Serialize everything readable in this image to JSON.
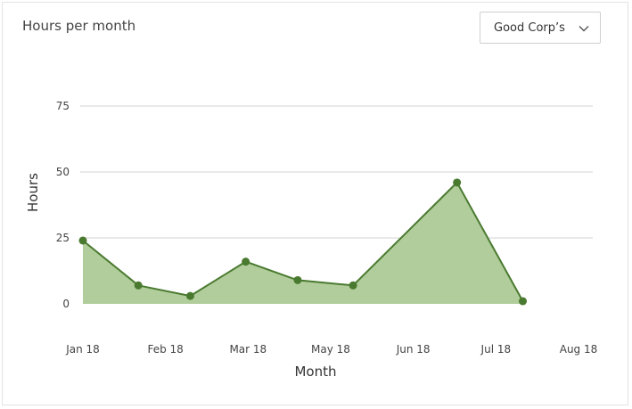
{
  "card": {
    "title": "Hours per month"
  },
  "dropdown": {
    "selected": "Good Corp’s"
  },
  "colors": {
    "line": "#4a7a30",
    "area": "#b1cd9b",
    "grid": "#d3d3d3"
  },
  "chart_data": {
    "type": "area",
    "title": "Hours per month",
    "xlabel": "Month",
    "ylabel": "Hours",
    "ylim": [
      0,
      75
    ],
    "yticks": [
      0,
      25,
      50,
      75
    ],
    "grid": true,
    "x_tick_labels": [
      "Jan 18",
      "Feb 18",
      "Mar 18",
      "May 18",
      "Jun 18",
      "Jul 18",
      "Aug 18"
    ],
    "x_range": [
      0,
      7.45
    ],
    "series": [
      {
        "x": [
          0,
          0.8,
          1.55,
          2.35,
          3.1,
          3.9,
          5.4,
          6.35
        ],
        "values": [
          24,
          7,
          3,
          16,
          9,
          7,
          46,
          1
        ]
      }
    ]
  }
}
